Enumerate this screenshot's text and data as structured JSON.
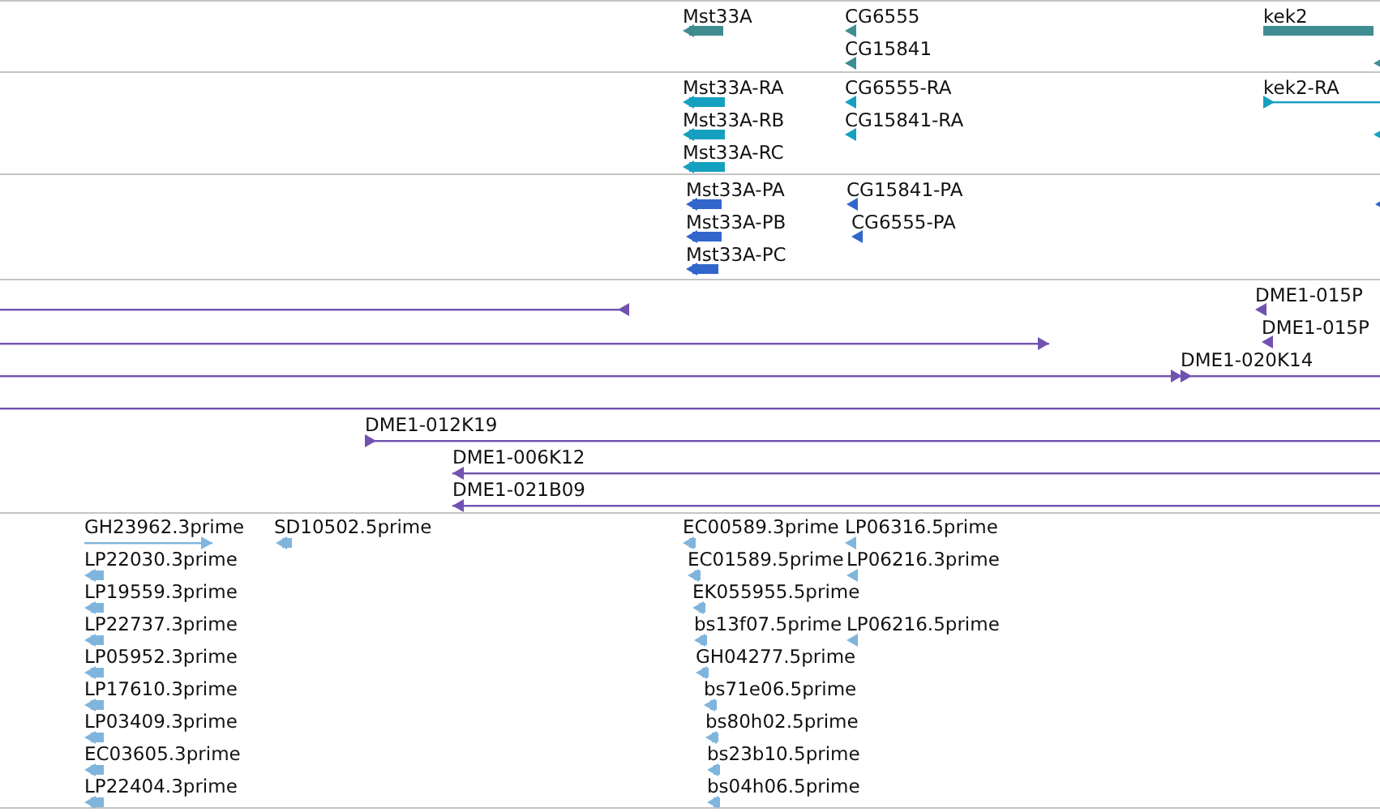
{
  "tracks": [
    {
      "color": "#3f8d91",
      "features": [
        {
          "label": "Mst33A",
          "kind": "bar",
          "reverse": true
        },
        {
          "label": "CG6555",
          "kind": "arrow",
          "reverse": true
        },
        {
          "label": "CG15841",
          "kind": "arrow",
          "reverse": true
        },
        {
          "label": "kek2",
          "kind": "bar"
        },
        {
          "kind": "arrow",
          "reverse": true
        }
      ]
    },
    {
      "color": "#15a0c0",
      "features": [
        {
          "label": "Mst33A-RA",
          "kind": "bar",
          "reverse": true
        },
        {
          "label": "Mst33A-RB",
          "kind": "bar",
          "reverse": true
        },
        {
          "label": "Mst33A-RC",
          "kind": "bar",
          "reverse": true
        },
        {
          "label": "CG6555-RA",
          "kind": "arrow",
          "reverse": true
        },
        {
          "label": "CG15841-RA",
          "kind": "arrow",
          "reverse": true
        },
        {
          "label": "kek2-RA",
          "kind": "line",
          "reverse": false
        },
        {
          "kind": "arrow",
          "reverse": true
        }
      ]
    },
    {
      "color": "#3366cc",
      "features": [
        {
          "label": "Mst33A-PA",
          "kind": "bar",
          "reverse": true
        },
        {
          "label": "Mst33A-PB",
          "kind": "bar",
          "reverse": true
        },
        {
          "label": "Mst33A-PC",
          "kind": "bar",
          "reverse": true
        },
        {
          "label": "CG15841-PA",
          "kind": "arrow",
          "reverse": true
        },
        {
          "label": "CG6555-PA",
          "kind": "arrow",
          "reverse": true
        },
        {
          "kind": "arrow",
          "reverse": true
        }
      ]
    },
    {
      "color": "#7152b0",
      "features": [
        {
          "kind": "line",
          "reverse": true
        },
        {
          "kind": "line",
          "reverse": false
        },
        {
          "kind": "line",
          "reverse": false
        },
        {
          "kind": "line"
        },
        {
          "label": "DME1-015P",
          "kind": "arrow",
          "reverse": true
        },
        {
          "label": "DME1-015P",
          "kind": "arrow",
          "reverse": true
        },
        {
          "label": "DME1-020K14",
          "kind": "line",
          "reverse": false
        },
        {
          "label": "DME1-012K19",
          "kind": "line",
          "reverse": false
        },
        {
          "label": "DME1-006K12",
          "kind": "line",
          "reverse": true
        },
        {
          "label": "DME1-021B09",
          "kind": "line",
          "reverse": true
        }
      ]
    },
    {
      "color": "#7fb5dd",
      "features": [
        {
          "label": "GH23962.3prime",
          "kind": "line",
          "reverse": false
        },
        {
          "label": "LP22030.3prime",
          "kind": "bar",
          "reverse": true
        },
        {
          "label": "LP19559.3prime",
          "kind": "bar",
          "reverse": true
        },
        {
          "label": "LP22737.3prime",
          "kind": "bar",
          "reverse": true
        },
        {
          "label": "LP05952.3prime",
          "kind": "bar",
          "reverse": true
        },
        {
          "label": "LP17610.3prime",
          "kind": "bar",
          "reverse": true
        },
        {
          "label": "LP03409.3prime",
          "kind": "bar",
          "reverse": true
        },
        {
          "label": "EC03605.3prime",
          "kind": "bar",
          "reverse": true
        },
        {
          "label": "LP22404.3prime",
          "kind": "bar",
          "reverse": true
        },
        {
          "label": "SD10502.5prime",
          "kind": "bar",
          "reverse": true
        },
        {
          "label": "EC00589.3prime",
          "kind": "bar",
          "reverse": true
        },
        {
          "label": "EC01589.5prime",
          "kind": "bar",
          "reverse": true
        },
        {
          "label": "EK055955.5prime",
          "kind": "bar",
          "reverse": true
        },
        {
          "label": "bs13f07.5prime",
          "kind": "bar",
          "reverse": true
        },
        {
          "label": "GH04277.5prime",
          "kind": "bar",
          "reverse": true
        },
        {
          "label": "bs71e06.5prime",
          "kind": "bar",
          "reverse": true
        },
        {
          "label": "bs80h02.5prime",
          "kind": "bar",
          "reverse": true
        },
        {
          "label": "bs23b10.5prime",
          "kind": "bar",
          "reverse": true
        },
        {
          "label": "bs04h06.5prime",
          "kind": "bar",
          "reverse": true
        },
        {
          "label": "LP06316.5prime",
          "kind": "arrow",
          "reverse": true
        },
        {
          "label": "LP06216.3prime",
          "kind": "arrow",
          "reverse": true
        },
        {
          "label": "LP06216.5prime",
          "kind": "arrow",
          "reverse": true
        }
      ]
    }
  ]
}
